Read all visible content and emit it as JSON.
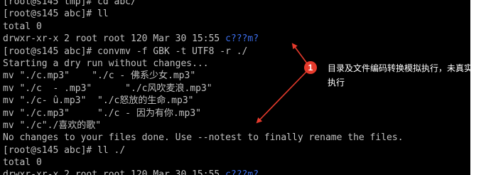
{
  "terminal": {
    "lines": [
      {
        "text": "[root@s145 tmp]# cd abc/",
        "highlight": ""
      },
      {
        "text": "[root@s145 abc]# ll",
        "highlight": ""
      },
      {
        "text": "total 0",
        "highlight": ""
      },
      {
        "text": "drwxr-xr-x 2 root root 120 Mar 30 15:55 ",
        "highlight": "c???m?"
      },
      {
        "text": "[root@s145 abc]# convmv -f GBK -t UTF8 -r ./",
        "highlight": ""
      },
      {
        "text": "Starting a dry run without changes...",
        "highlight": ""
      },
      {
        "text": "mv \"./c.mp3\"    \"./c - 佛系少女.mp3\"",
        "highlight": ""
      },
      {
        "text": "mv \"./c  - .mp3\"      \"./c风吹麦浪.mp3\"",
        "highlight": ""
      },
      {
        "text": "mv \"./c- û.mp3\"  \"./c怒放的生命.mp3\"",
        "highlight": ""
      },
      {
        "text": "mv \"./c.mp3\"     \"./c - 因为有你.mp3\"",
        "highlight": ""
      },
      {
        "text": "mv \"./c\"./喜欢的歌\"",
        "highlight": ""
      },
      {
        "text": "No changes to your files done. Use --notest to finally rename the files.",
        "highlight": ""
      },
      {
        "text": "[root@s145 abc]# ll ./",
        "highlight": ""
      },
      {
        "text": "total 0",
        "highlight": ""
      },
      {
        "text": "drwxr-xr-x 2 root root 120 Mar 30 15:55 ",
        "highlight": "c???m?"
      }
    ]
  },
  "annotation": {
    "badge": "1",
    "note": "目录及文件编码转换模拟执行，未真实执行"
  },
  "colors": {
    "terminal_bg": "#000000",
    "terminal_fg": "#c0c0c0",
    "dir_highlight": "#3c6eea",
    "annotation_red": "#e53a2c"
  }
}
